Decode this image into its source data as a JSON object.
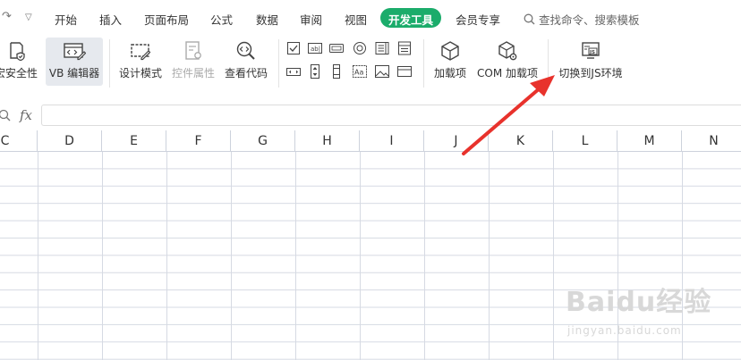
{
  "menubar": {
    "tabs": [
      "开始",
      "插入",
      "页面布局",
      "公式",
      "数据",
      "审阅",
      "视图",
      "开发工具",
      "会员专享"
    ],
    "active_tab": "开发工具",
    "search_placeholder": "查找命令、搜索模板"
  },
  "ribbon": {
    "macro_security": "宏安全性",
    "vb_editor": "VB 编辑器",
    "design_mode": "设计模式",
    "control_props": "控件属性",
    "view_code": "查看代码",
    "addins": "加载项",
    "com_addins": "COM 加载项",
    "switch_js": "切换到JS环境"
  },
  "formula_bar": {
    "fx_label": "fx",
    "value": ""
  },
  "grid": {
    "columns": [
      "C",
      "D",
      "E",
      "F",
      "G",
      "H",
      "I",
      "J",
      "K",
      "L",
      "M",
      "N"
    ]
  },
  "colors": {
    "accent": "#1bac6b",
    "arrow": "#e8322c"
  },
  "watermark": {
    "text": "Baidu经验",
    "sub": "jingyan.baidu.com"
  }
}
